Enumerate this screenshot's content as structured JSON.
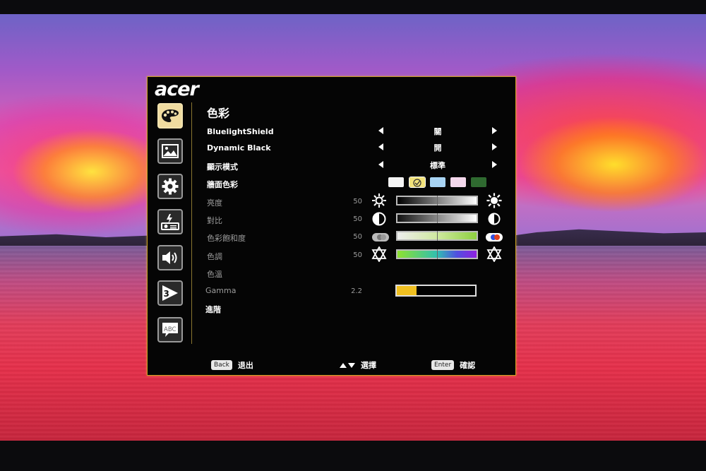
{
  "brand": "acer",
  "menu": {
    "title": "色彩",
    "sidebar": [
      {
        "name": "palette-icon",
        "active": true
      },
      {
        "name": "image-icon",
        "active": false
      },
      {
        "name": "gear-icon",
        "active": false
      },
      {
        "name": "projector-power-icon",
        "active": false
      },
      {
        "name": "speaker-icon",
        "active": false
      },
      {
        "name": "3d-icon",
        "active": false
      },
      {
        "name": "language-abc-icon",
        "active": false
      }
    ],
    "rows": {
      "bluelight": {
        "label": "BluelightShield",
        "value": "關"
      },
      "dynamic_black": {
        "label": "Dynamic Black",
        "value": "開"
      },
      "display_mode": {
        "label": "顯示模式",
        "value": "標準"
      },
      "wall_color": {
        "label": "牆面色彩",
        "options": [
          "#f4f4f4",
          "#f2e27a",
          "#a8d4f4",
          "#f4d8ec",
          "#2f6a30"
        ],
        "selected": 1
      },
      "brightness": {
        "label": "亮度",
        "value": "50",
        "level": 0.5
      },
      "contrast": {
        "label": "對比",
        "value": "50",
        "level": 0.5
      },
      "saturation": {
        "label": "色彩飽和度",
        "value": "50",
        "level": 0.5
      },
      "tint": {
        "label": "色調",
        "value": "50",
        "level": 0.5
      },
      "color_temp": {
        "label": "色溫"
      },
      "gamma": {
        "label": "Gamma",
        "value": "2.2",
        "level": 0.25
      },
      "advanced": {
        "label": "進階"
      }
    },
    "footer": {
      "back_key": "Back",
      "back_label": "退出",
      "select_label": "選擇",
      "enter_key": "Enter",
      "enter_label": "確認"
    }
  },
  "colors": {
    "frame": "#c9a020",
    "gamma_fill": "#f0c020"
  }
}
